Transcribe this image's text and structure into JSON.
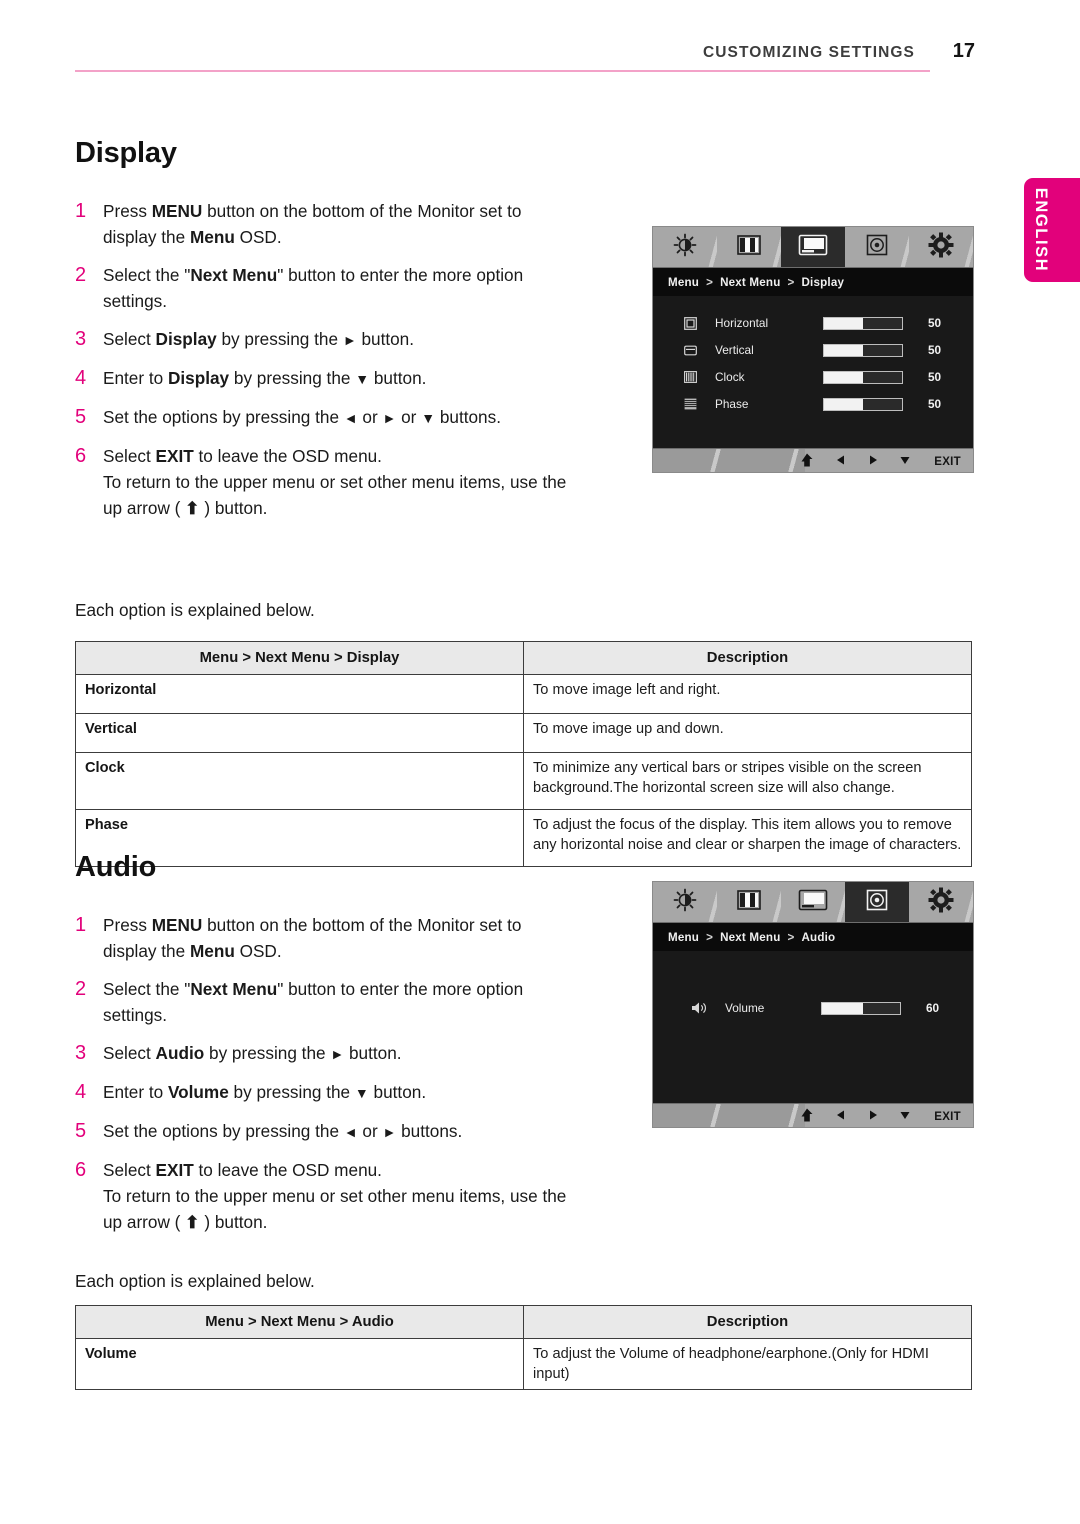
{
  "header": {
    "chapter_title": "CUSTOMIZING SETTINGS",
    "page_number": "17"
  },
  "language_tab": {
    "label": "ENGLISH",
    "color": "#e2017b"
  },
  "sections": [
    {
      "id": "display",
      "title": "Display",
      "each_option_note": "Each option is explained below.",
      "steps": [
        {
          "num": "1",
          "html": "Press <b>MENU</b> button on the bottom of the Monitor set to display the <b>Menu</b> OSD."
        },
        {
          "num": "2",
          "html": "Select the \"<b>Next Menu</b>\" button to enter the more option settings."
        },
        {
          "num": "3",
          "html": "Select <b>Display</b> by pressing the <span class=\"arw\">&#9658;</span> button."
        },
        {
          "num": "4",
          "html": "Enter to <b>Display</b> by pressing the <span class=\"arw\">&#9660;</span> button."
        },
        {
          "num": "5",
          "html": "Set the options by pressing the <span class=\"arw\">&#9668;</span> or <span class=\"arw\">&#9658;</span> or <span class=\"arw\">&#9660;</span> buttons."
        },
        {
          "num": "6",
          "html": "Select <b>EXIT</b> to leave the OSD menu.<br>To return to the upper menu or set other menu items, use the up arrow ( <b>&#11014;</b> ) button."
        }
      ],
      "table": {
        "col1_header": "Menu > Next Menu > Display",
        "col2_header": "Description",
        "rows": [
          {
            "name": "Horizontal",
            "desc": "To move image left and right.",
            "tall": false
          },
          {
            "name": "Vertical",
            "desc": "To move image up and down.",
            "tall": false
          },
          {
            "name": "Clock",
            "desc": "To minimize any vertical bars or stripes visible on the screen background.The horizontal screen size will also change.",
            "tall": true
          },
          {
            "name": "Phase",
            "desc": "To adjust the focus of the display. This item allows you to remove any horizontal noise and clear or sharpen the image of characters.",
            "tall": true
          }
        ]
      },
      "osd": {
        "breadcrumb": [
          "Menu",
          "Next Menu",
          "Display"
        ],
        "active_tab_index": 2,
        "tabs": [
          "brightness-icon",
          "color-bars-icon",
          "screen-icon",
          "disc-icon",
          "gear-icon"
        ],
        "items": [
          {
            "icon": "horizontal-move-icon",
            "label": "Horizontal",
            "value": "50",
            "fill_pct": 50
          },
          {
            "icon": "vertical-move-icon",
            "label": "Vertical",
            "value": "50",
            "fill_pct": 50
          },
          {
            "icon": "clock-pattern-icon",
            "label": "Clock",
            "value": "50",
            "fill_pct": 50
          },
          {
            "icon": "phase-pattern-icon",
            "label": "Phase",
            "value": "50",
            "fill_pct": 50
          }
        ],
        "footer": [
          "up-arrow-icon",
          "left-arrow-icon",
          "right-arrow-icon",
          "down-arrow-icon",
          "EXIT"
        ]
      }
    },
    {
      "id": "audio",
      "title": "Audio",
      "each_option_note": "Each option is explained below.",
      "steps": [
        {
          "num": "1",
          "html": "Press <b>MENU</b> button on the bottom of the Monitor set to display the <b>Menu</b> OSD."
        },
        {
          "num": "2",
          "html": "Select the \"<b>Next Menu</b>\" button to enter the more option settings."
        },
        {
          "num": "3",
          "html": "Select <b>Audio</b> by pressing the <span class=\"arw\">&#9658;</span> button."
        },
        {
          "num": "4",
          "html": "Enter to <b>Volume</b> by pressing the <span class=\"arw\">&#9660;</span> button."
        },
        {
          "num": "5",
          "html": "Set the options by pressing the <span class=\"arw\">&#9668;</span> or <span class=\"arw\">&#9658;</span> buttons."
        },
        {
          "num": "6",
          "html": "Select <b>EXIT</b> to leave the OSD menu.<br>To return to the upper menu or set other menu items, use the up arrow ( <b>&#11014;</b> ) button."
        }
      ],
      "table": {
        "col1_header": "Menu > Next Menu > Audio",
        "col2_header": "Description",
        "rows": [
          {
            "name": "Volume",
            "desc": "To adjust the Volume of headphone/earphone.(Only for HDMI input)",
            "tall": false
          }
        ]
      },
      "osd": {
        "breadcrumb": [
          "Menu",
          "Next Menu",
          "Audio"
        ],
        "active_tab_index": 3,
        "tabs": [
          "brightness-icon",
          "color-bars-icon",
          "screen-icon",
          "disc-icon",
          "gear-icon"
        ],
        "items": [
          {
            "icon": "speaker-icon",
            "label": "Volume",
            "value": "60",
            "fill_pct": 52
          }
        ],
        "footer": [
          "up-arrow-icon",
          "left-arrow-icon",
          "right-arrow-icon",
          "down-arrow-icon",
          "EXIT"
        ]
      }
    }
  ]
}
